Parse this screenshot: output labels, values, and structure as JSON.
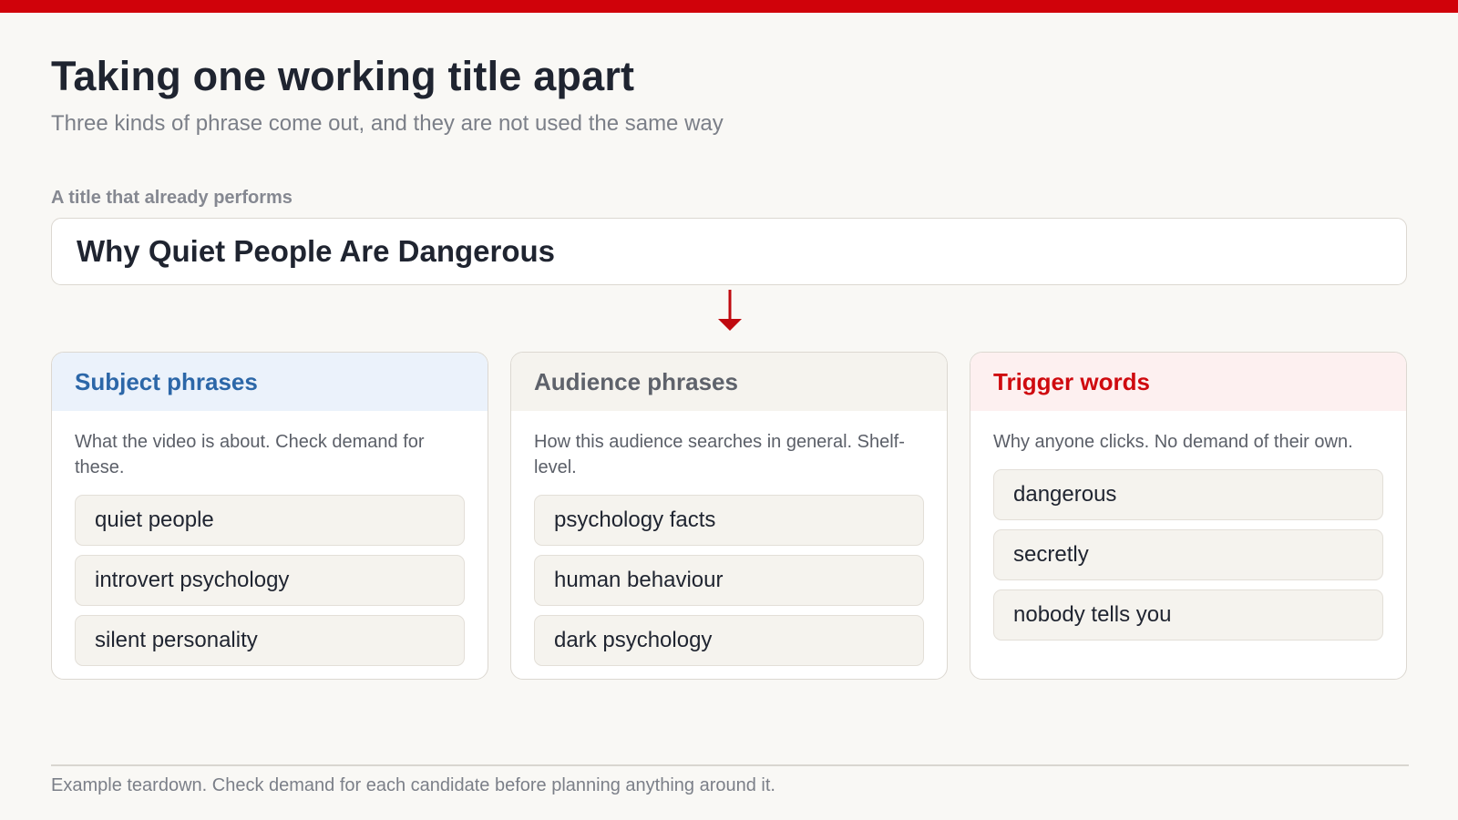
{
  "header": {
    "title": "Taking one working title apart",
    "subtitle": "Three kinds of phrase come out, and they are not used the same way"
  },
  "example": {
    "label": "A title that already performs",
    "title": "Why Quiet People Are Dangerous"
  },
  "arrow_icon": "arrow-down-icon",
  "columns": [
    {
      "title": "Subject phrases",
      "description": "What the video is about. Check demand for these.",
      "header_bg": "#ebf2fb",
      "header_color": "#2c67a8",
      "phrases": [
        "quiet people",
        "introvert psychology",
        "silent personality"
      ]
    },
    {
      "title": "Audience phrases",
      "description": "How this audience searches in general. Shelf-level.",
      "header_bg": "#f5f3ee",
      "header_color": "#5e626b",
      "phrases": [
        "psychology facts",
        "human behaviour",
        "dark psychology"
      ]
    },
    {
      "title": "Trigger words",
      "description": "Why anyone clicks. No demand of their own.",
      "header_bg": "#fdf0f0",
      "header_color": "#cf0a0f",
      "phrases": [
        "dangerous",
        "secretly",
        "nobody tells you"
      ]
    }
  ],
  "footer": {
    "note": "Example teardown. Check demand for each candidate before planning anything around it."
  },
  "colors": {
    "accent": "#d0020a",
    "background": "#f9f8f5"
  }
}
